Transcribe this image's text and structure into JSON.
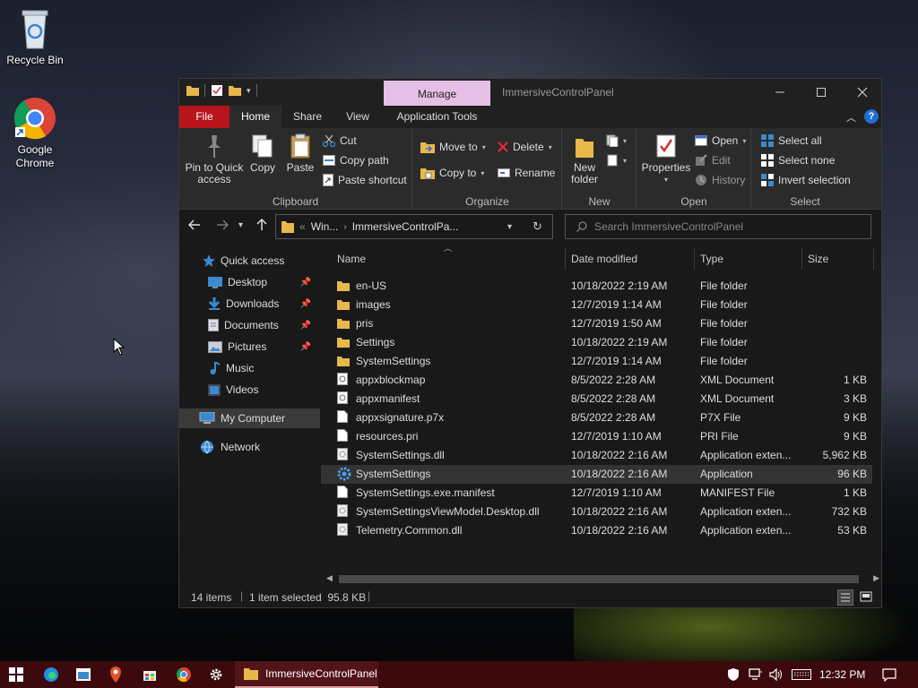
{
  "desktop": {
    "icons": [
      {
        "label": "Recycle Bin"
      },
      {
        "label": "Google Chrome"
      }
    ]
  },
  "window": {
    "title": "ImmersiveControlPanel",
    "context_tab": "Manage",
    "tabs": [
      "File",
      "Home",
      "Share",
      "View",
      "Application Tools"
    ],
    "ribbon": {
      "clipboard": {
        "label": "Clipboard",
        "pin": "Pin to Quick access",
        "copy": "Copy",
        "paste": "Paste",
        "cut": "Cut",
        "copy_path": "Copy path",
        "paste_shortcut": "Paste shortcut"
      },
      "organize": {
        "label": "Organize",
        "move_to": "Move to",
        "copy_to": "Copy to",
        "delete": "Delete",
        "rename": "Rename"
      },
      "new": {
        "label": "New",
        "new_folder": "New folder"
      },
      "open": {
        "label": "Open",
        "properties": "Properties",
        "open": "Open",
        "edit": "Edit",
        "history": "History"
      },
      "select": {
        "label": "Select",
        "select_all": "Select all",
        "select_none": "Select none",
        "invert": "Invert selection"
      }
    },
    "address": {
      "crumb_1": "Win...",
      "crumb_2": "ImmersiveControlPa...",
      "overflow": "«"
    },
    "search_placeholder": "Search ImmersiveControlPanel",
    "sidebar": [
      {
        "label": "Quick access",
        "pinned": false
      },
      {
        "label": "Desktop",
        "pinned": true
      },
      {
        "label": "Downloads",
        "pinned": true
      },
      {
        "label": "Documents",
        "pinned": true
      },
      {
        "label": "Pictures",
        "pinned": true
      },
      {
        "label": "Music",
        "pinned": false
      },
      {
        "label": "Videos",
        "pinned": false
      },
      {
        "label": "My Computer",
        "pinned": false
      },
      {
        "label": "Network",
        "pinned": false
      }
    ],
    "columns": [
      "Name",
      "Date modified",
      "Type",
      "Size"
    ],
    "files": [
      {
        "name": "en-US",
        "date": "10/18/2022 2:19 AM",
        "type": "File folder",
        "size": "",
        "icon": "folder"
      },
      {
        "name": "images",
        "date": "12/7/2019 1:14 AM",
        "type": "File folder",
        "size": "",
        "icon": "folder"
      },
      {
        "name": "pris",
        "date": "12/7/2019 1:50 AM",
        "type": "File folder",
        "size": "",
        "icon": "folder"
      },
      {
        "name": "Settings",
        "date": "10/18/2022 2:19 AM",
        "type": "File folder",
        "size": "",
        "icon": "folder"
      },
      {
        "name": "SystemSettings",
        "date": "12/7/2019 1:14 AM",
        "type": "File folder",
        "size": "",
        "icon": "folder"
      },
      {
        "name": "appxblockmap",
        "date": "8/5/2022 2:28 AM",
        "type": "XML Document",
        "size": "1 KB",
        "icon": "xml"
      },
      {
        "name": "appxmanifest",
        "date": "8/5/2022 2:28 AM",
        "type": "XML Document",
        "size": "3 KB",
        "icon": "xml"
      },
      {
        "name": "appxsignature.p7x",
        "date": "8/5/2022 2:28 AM",
        "type": "P7X File",
        "size": "9 KB",
        "icon": "file"
      },
      {
        "name": "resources.pri",
        "date": "12/7/2019 1:10 AM",
        "type": "PRI File",
        "size": "9 KB",
        "icon": "file"
      },
      {
        "name": "SystemSettings.dll",
        "date": "10/18/2022 2:16 AM",
        "type": "Application exten...",
        "size": "5,962 KB",
        "icon": "dll"
      },
      {
        "name": "SystemSettings",
        "date": "10/18/2022 2:16 AM",
        "type": "Application",
        "size": "96 KB",
        "icon": "gear",
        "selected": true
      },
      {
        "name": "SystemSettings.exe.manifest",
        "date": "12/7/2019 1:10 AM",
        "type": "MANIFEST File",
        "size": "1 KB",
        "icon": "file"
      },
      {
        "name": "SystemSettingsViewModel.Desktop.dll",
        "date": "10/18/2022 2:16 AM",
        "type": "Application exten...",
        "size": "732 KB",
        "icon": "dll"
      },
      {
        "name": "Telemetry.Common.dll",
        "date": "10/18/2022 2:16 AM",
        "type": "Application exten...",
        "size": "53 KB",
        "icon": "dll"
      }
    ],
    "status": {
      "items": "14 items",
      "selected": "1 item selected  95.8 KB"
    }
  },
  "taskbar": {
    "active_app": "ImmersiveControlPanel",
    "clock": "12:32 PM"
  },
  "colors": {
    "file_tab": "#b8141c",
    "manage_tab": "#e6bfe6",
    "taskbar": "#3c0a0c",
    "folder": "#e8b84a"
  }
}
